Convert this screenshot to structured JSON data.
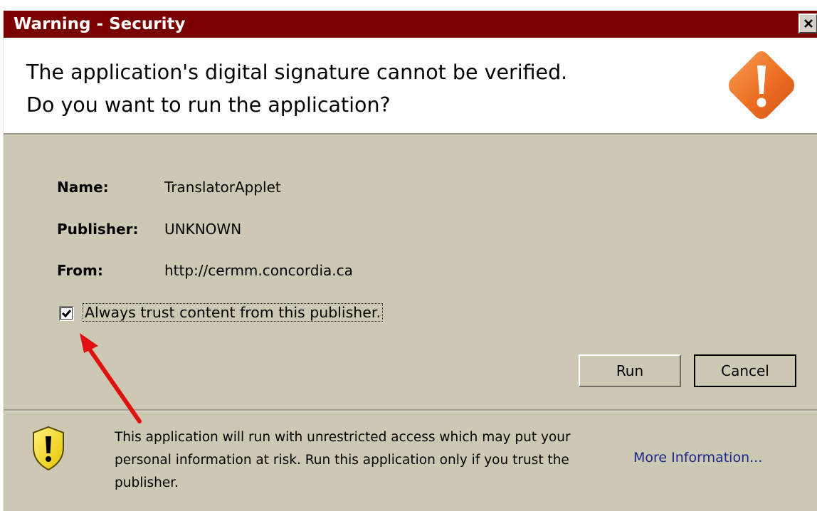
{
  "window": {
    "title": "Warning - Security",
    "close_glyph": "✕"
  },
  "header": {
    "line1": "The application's digital signature cannot be verified.",
    "line2": "Do you want to run the application?",
    "icon": "warning-diamond-icon",
    "icon_color": "#e8702a"
  },
  "fields": {
    "name_label": "Name:",
    "name_value": "TranslatorApplet",
    "publisher_label": "Publisher:",
    "publisher_value": "UNKNOWN",
    "from_label": "From:",
    "from_value": "http://cermm.concordia.ca"
  },
  "trust_checkbox": {
    "label": "Always trust content from this publisher.",
    "checked": true
  },
  "buttons": {
    "run": "Run",
    "cancel": "Cancel"
  },
  "footer": {
    "message": "This application will run with unrestricted access which may put your personal information at risk. Run this application only if you trust the publisher.",
    "link": "More Information...",
    "icon": "shield-warning-icon"
  },
  "annotation": {
    "icon": "red-arrow-icon",
    "color": "#e01010"
  },
  "colors": {
    "titlebar": "#7a0000",
    "dialog_bg": "#ccc8b3"
  }
}
